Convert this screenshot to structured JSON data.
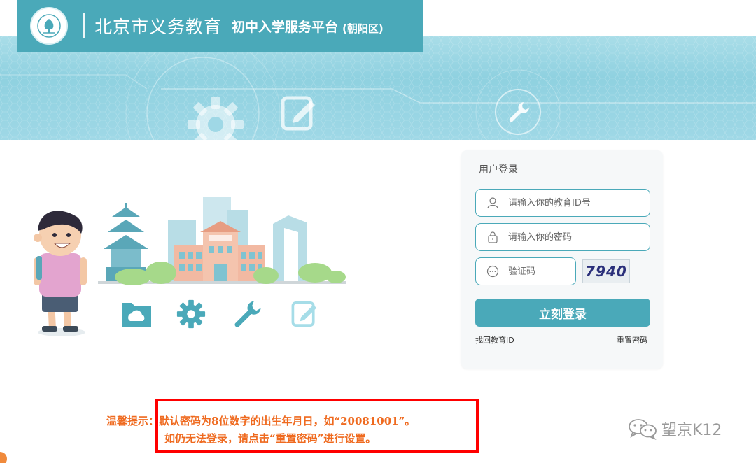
{
  "header": {
    "title": "北京市义务教育",
    "subtitle": "初中入学服务平台",
    "district": "(朝阳区)"
  },
  "login": {
    "title": "用户登录",
    "id_placeholder": "请输入你的教育ID号",
    "password_placeholder": "请输入你的密码",
    "captcha_placeholder": "验证码",
    "captcha_code": "7940",
    "submit_label": "立刻登录",
    "recover_id_link": "找回教育ID",
    "reset_password_link": "重置密码"
  },
  "notice": {
    "line1": "温馨提示：默认密码为8位数字的出生年月日，如“20081001”。",
    "line2": "如仍无法登录，请点击“重置密码”进行设置。"
  },
  "watermark": {
    "text": "望京K12",
    "icon": "wechat-icon"
  },
  "icons": [
    "user-icon",
    "lock-icon",
    "captcha-icon",
    "gear-icon",
    "edit-icon",
    "wrench-icon",
    "folder-cloud-icon"
  ],
  "colors": {
    "primary": "#4aa9b9",
    "banner": "#9fd8e6",
    "notice_text": "#ef6a1f",
    "notice_border": "#ff0000"
  }
}
